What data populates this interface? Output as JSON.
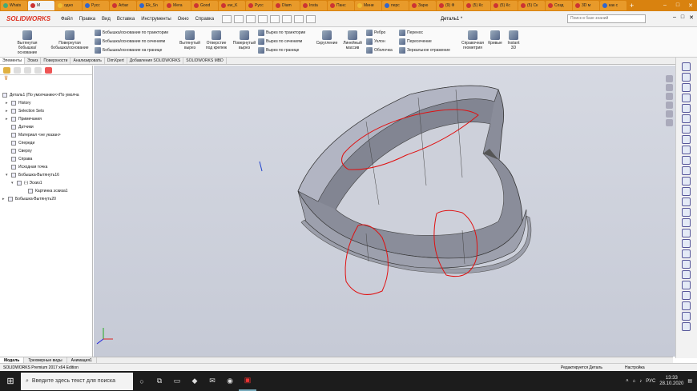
{
  "browser": {
    "tabs": [
      "Whats",
      "M",
      "одно",
      "Русс",
      "Arbar",
      "Ek_Sn",
      "Мега",
      "Good",
      "ew_K",
      "Русс",
      "Diam",
      "Insta",
      "Панс",
      "Мини",
      "перс",
      "Зарю",
      "(9) Ф",
      "(5) Кс",
      "(5) Кс",
      "(5) Ск",
      "Созд",
      "3D м",
      "как с"
    ],
    "new_tab": "+"
  },
  "menubar": {
    "logo": "SOLIDWORKS",
    "items": [
      "Файл",
      "Правка",
      "Вид",
      "Вставка",
      "Инструменты",
      "Окно",
      "Справка"
    ],
    "doc_title": "Деталь1 *",
    "search_placeholder": "Поиск в базе знаний"
  },
  "ribbon": {
    "extrude_boss": "Вытянутая бобышка/основание",
    "revolve_boss": "Повернутая бобышка/основание",
    "sweep_boss": "Бобышка/основание по траектории",
    "loft_boss": "Бобышка/основание по сечениям",
    "boundary_boss": "Бобышка/основание на границе",
    "extrude_cut": "Вытянутый вырез",
    "hole_wizard": "Отверстие под крепеж",
    "revolve_cut": "Повернутый вырез",
    "sweep_cut": "Вырез по траектории",
    "loft_cut": "Вырез по сечениям",
    "boundary_cut": "Вырез по границе",
    "fillet": "Скругление",
    "linear_pattern": "Линейный массив",
    "rib": "Ребро",
    "draft": "Уклон",
    "shell": "Оболочка",
    "wrap": "Перенос",
    "intersect": "Пересечение",
    "mirror": "Зеркальное отражение",
    "ref_geometry": "Справочная геометрия",
    "curves": "Кривые",
    "instant3d": "Instant 3D"
  },
  "command_tabs": [
    "Элементы",
    "Эскиз",
    "Поверхности",
    "Анализировать",
    "DimXpert",
    "Добавления SOLIDWORKS",
    "SOLIDWORKS MBD"
  ],
  "tree": {
    "root": "Деталь1 (По умолчанию<<По умолча",
    "items": [
      {
        "label": "History",
        "exp": "▸"
      },
      {
        "label": "Selection Sets",
        "exp": "▸"
      },
      {
        "label": "Примечания",
        "exp": "▸"
      },
      {
        "label": "Датчики",
        "exp": ""
      },
      {
        "label": "Материал <не указан>",
        "exp": ""
      },
      {
        "label": "Спереди",
        "exp": ""
      },
      {
        "label": "Сверху",
        "exp": ""
      },
      {
        "label": "Справа",
        "exp": ""
      },
      {
        "label": "Исходная точка",
        "exp": ""
      },
      {
        "label": "Бобышка-Вытянуть16",
        "exp": "▾"
      },
      {
        "label": "(-) Эскиз1",
        "exp": "▾"
      },
      {
        "label": "Картинка эскиза1",
        "exp": ""
      },
      {
        "label": "Бобышка-Вытянуть20",
        "exp": "▸"
      }
    ]
  },
  "bottom_tabs": [
    "Модель",
    "Трехмерные виды",
    "Анимация1"
  ],
  "status": {
    "edition": "SOLIDWORKS Premium 2017 x64 Edition",
    "editing": "Редактируется Деталь",
    "config": "Настройка"
  },
  "taskbar": {
    "search_placeholder": "Введите здесь текст для поиска",
    "lang": "РУС",
    "time": "13:33",
    "date": "28.10.2020"
  },
  "colors": {
    "browser_bar": "#d9820f",
    "sketch_marker": "#e01010",
    "part_face": "#8a8d9a"
  }
}
